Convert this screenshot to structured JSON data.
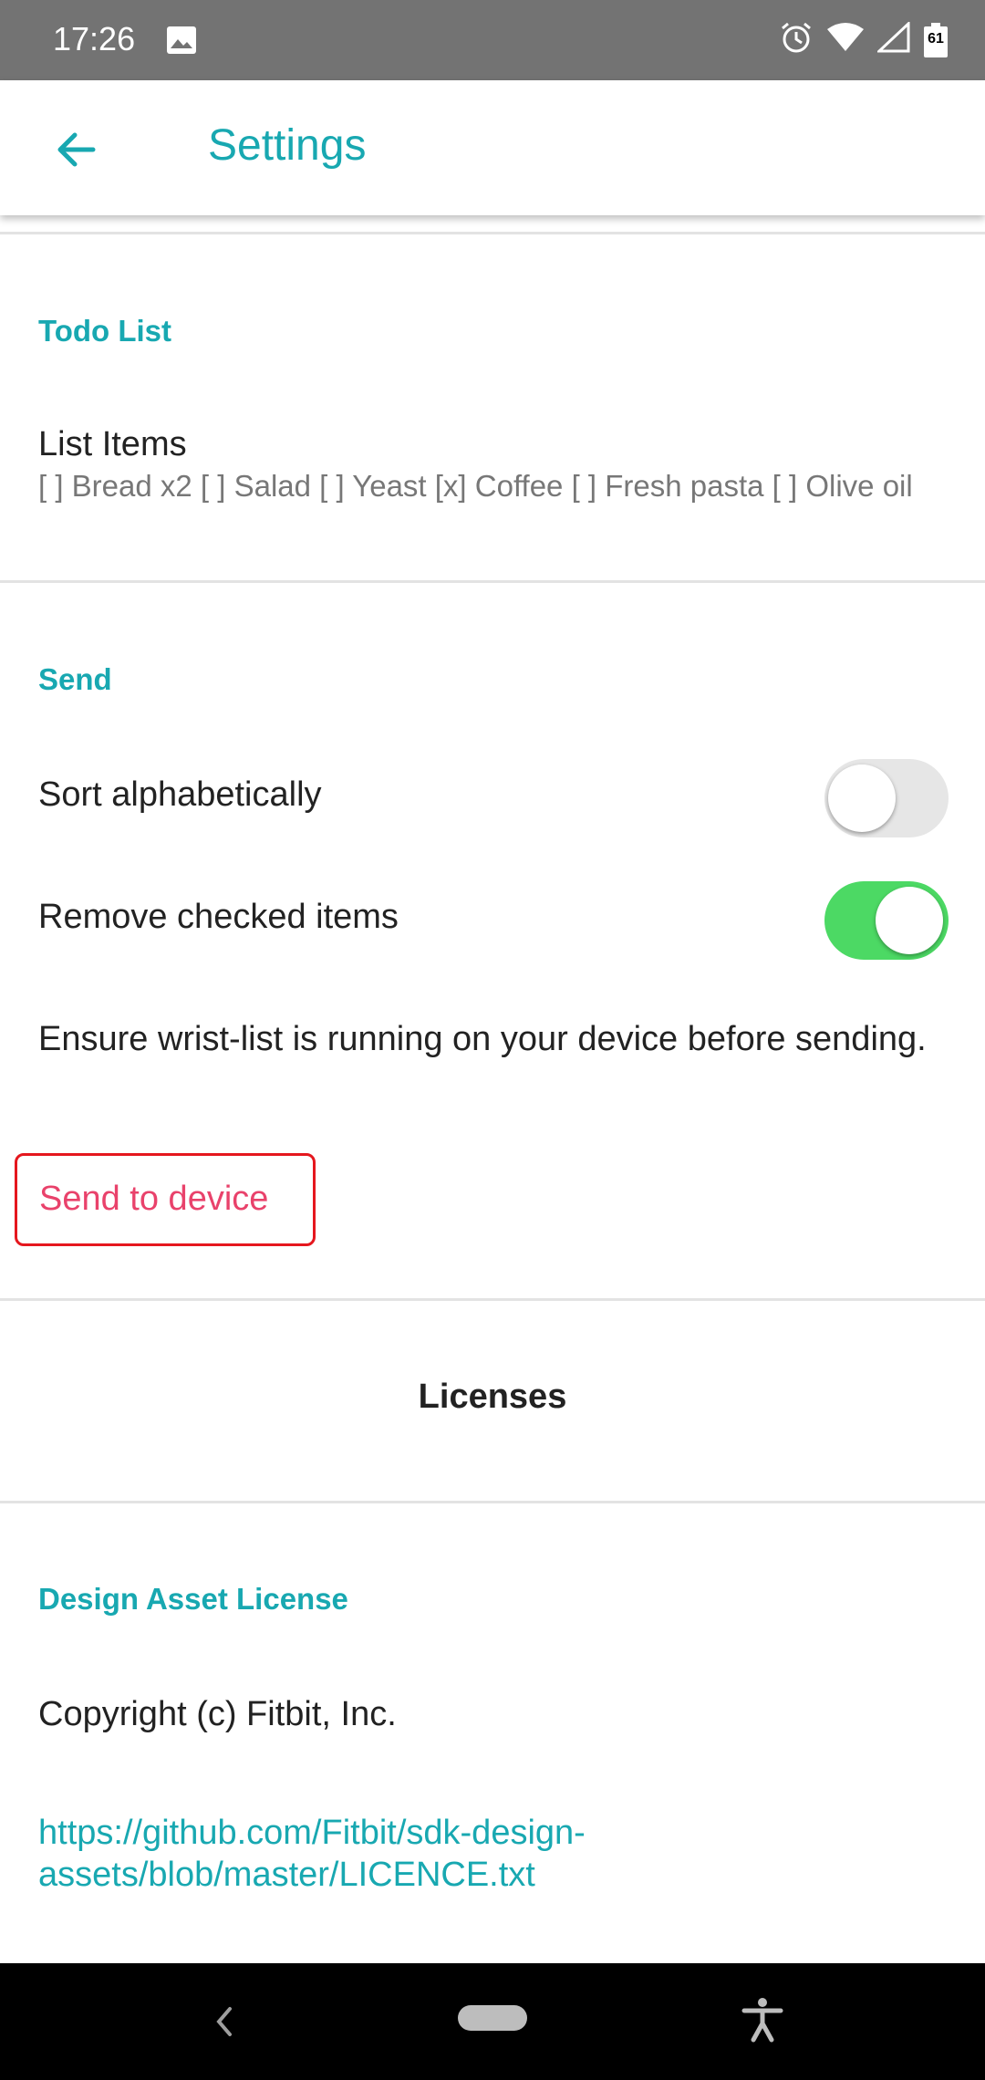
{
  "status_bar": {
    "time": "17:26",
    "battery": "61"
  },
  "app_bar": {
    "title": "Settings"
  },
  "todo_section": {
    "header": "Todo List",
    "list_items_title": "List Items",
    "list_items_value": "[ ] Bread x2 [ ] Salad [ ] Yeast [x] Coffee [ ] Fresh pasta [ ] Olive oil"
  },
  "send_section": {
    "header": "Send",
    "sort_label": "Sort alphabetically",
    "sort_enabled": false,
    "remove_label": "Remove checked items",
    "remove_enabled": true,
    "note": "Ensure wrist-list is running on your device before sending.",
    "send_button": "Send to device"
  },
  "licenses": {
    "title": "Licenses",
    "design_header": "Design Asset License",
    "copyright": "Copyright (c) Fitbit, Inc.",
    "link": "https://github.com/Fitbit/sdk-design-assets/blob/master/LICENCE.txt"
  },
  "colors": {
    "accent": "#18a8b1",
    "toggle_on": "#4cd964",
    "send_text": "#e9426b",
    "highlight_border": "#e5171e"
  }
}
